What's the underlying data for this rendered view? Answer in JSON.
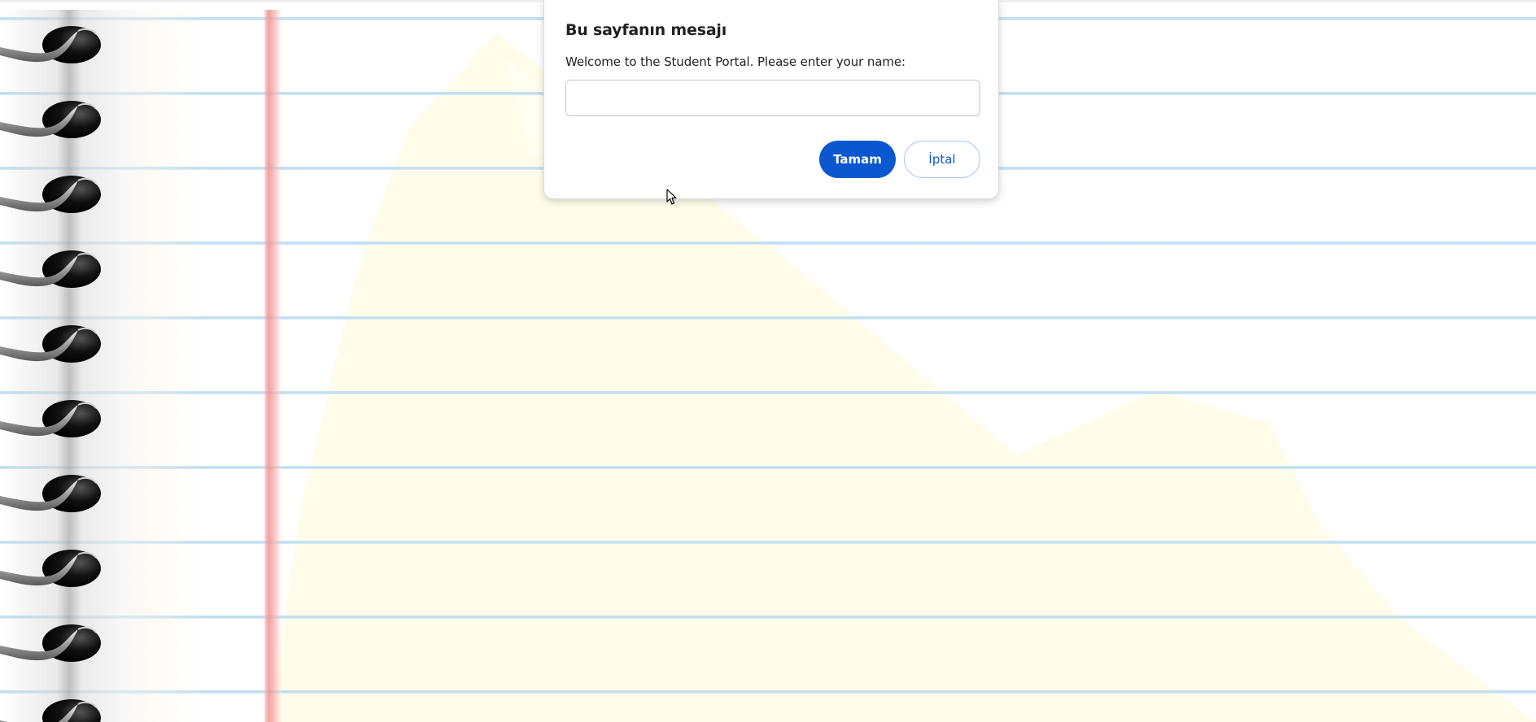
{
  "dialog": {
    "title": "Bu sayfanın mesajı",
    "message": "Welcome to the Student Portal. Please enter your name:",
    "input_value": "",
    "ok_label": "Tamam",
    "cancel_label": "İptal"
  },
  "colors": {
    "primary_button": "#0b57d0",
    "ruled_line": "#bddced",
    "margin_line": "#f09696",
    "watermark": "#fffde8"
  },
  "icons": {
    "cursor": "mouse-pointer-icon",
    "spiral_ring": "spiral-ring-icon"
  }
}
